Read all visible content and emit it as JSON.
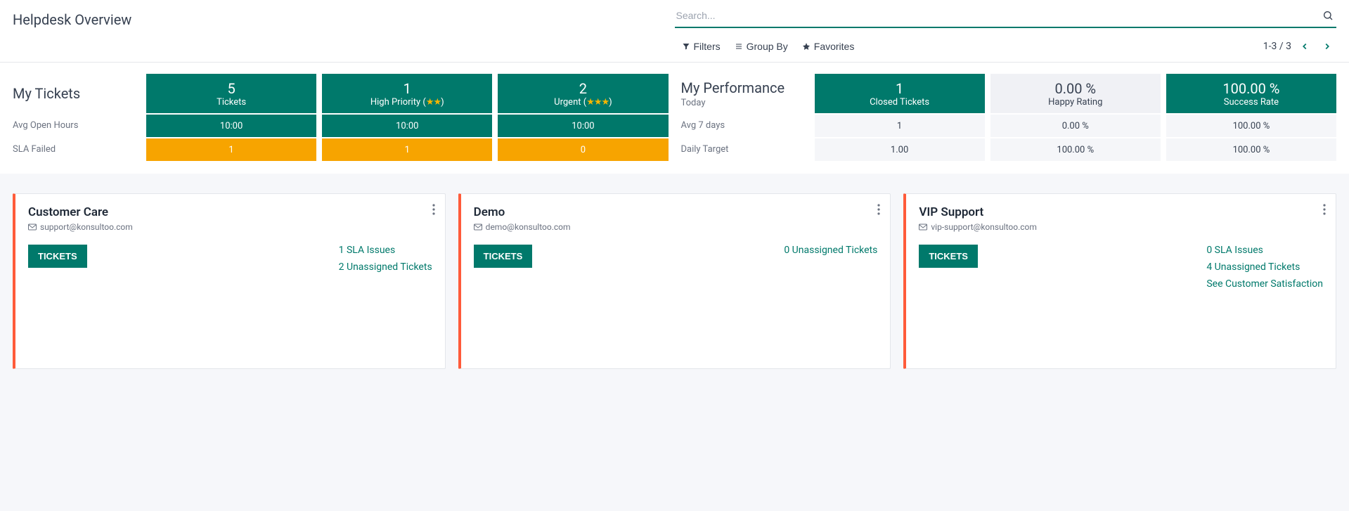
{
  "header": {
    "title": "Helpdesk Overview",
    "search_placeholder": "Search...",
    "filters_label": "Filters",
    "groupby_label": "Group By",
    "favorites_label": "Favorites",
    "pager_text": "1-3 / 3"
  },
  "my_tickets": {
    "heading": "My Tickets",
    "row_avg_label": "Avg Open Hours",
    "row_sla_label": "SLA Failed",
    "cols": [
      {
        "big": "5",
        "label_prefix": "Tickets",
        "stars": 0,
        "avg": "10:00",
        "sla": "1"
      },
      {
        "big": "1",
        "label_prefix": "High Priority",
        "stars": 2,
        "avg": "10:00",
        "sla": "1"
      },
      {
        "big": "2",
        "label_prefix": "Urgent",
        "stars": 3,
        "avg": "10:00",
        "sla": "0"
      }
    ]
  },
  "my_performance": {
    "heading": "My Performance",
    "sub_today": "Today",
    "row_avg7_label": "Avg 7 days",
    "row_target_label": "Daily Target",
    "cols": [
      {
        "big": "1",
        "label": "Closed Tickets",
        "highlight": true,
        "avg7": "1",
        "target": "1.00"
      },
      {
        "big": "0.00 %",
        "label": "Happy Rating",
        "highlight": false,
        "avg7": "0.00 %",
        "target": "100.00 %"
      },
      {
        "big": "100.00 %",
        "label": "Success Rate",
        "highlight": true,
        "avg7": "100.00 %",
        "target": "100.00 %"
      }
    ]
  },
  "teams": [
    {
      "name": "Customer Care",
      "email": "support@konsultoo.com",
      "button": "TICKETS",
      "links": [
        "1 SLA Issues",
        "2 Unassigned Tickets"
      ]
    },
    {
      "name": "Demo",
      "email": "demo@konsultoo.com",
      "button": "TICKETS",
      "links": [
        "0 Unassigned Tickets"
      ]
    },
    {
      "name": "VIP Support",
      "email": "vip-support@konsultoo.com",
      "button": "TICKETS",
      "links": [
        "0 SLA Issues",
        "4 Unassigned Tickets",
        "See Customer Satisfaction"
      ]
    }
  ]
}
